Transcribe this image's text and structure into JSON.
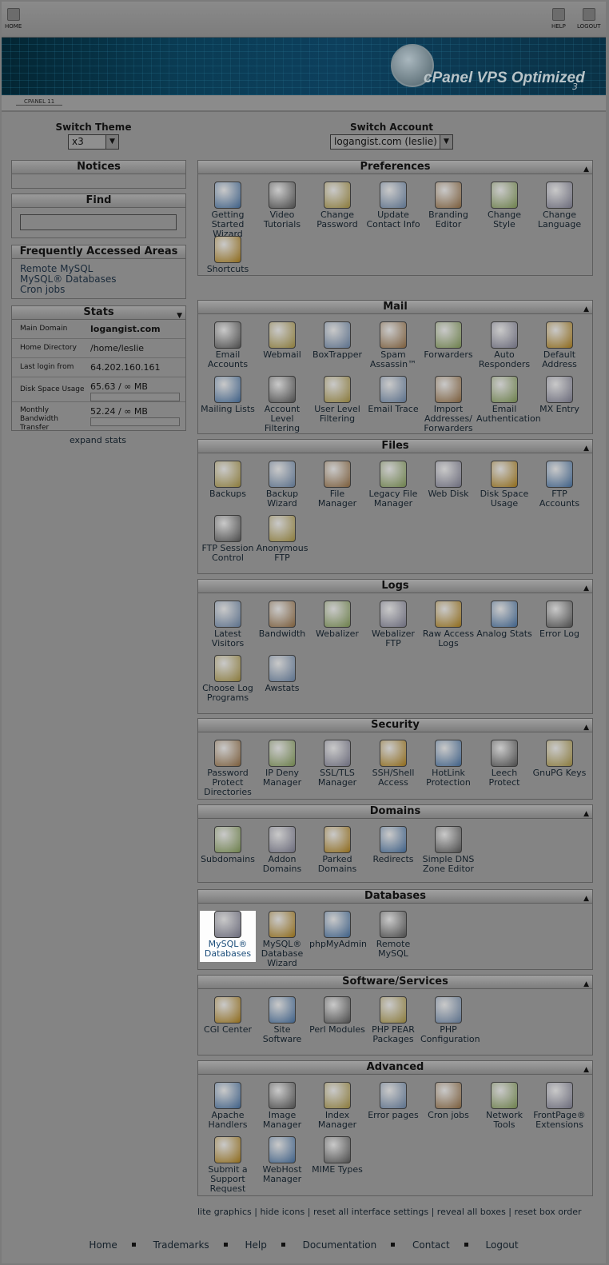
{
  "topbar": {
    "home_label": "HOME",
    "help_label": "HELP",
    "logout_label": "LOGOUT"
  },
  "banner": {
    "brand": "cPanel VPS Optimized",
    "brand_sub": "3"
  },
  "subbar": {
    "tab": "CPANEL 11"
  },
  "switch_theme": {
    "label": "Switch Theme",
    "value": "x3"
  },
  "switch_account": {
    "label": "Switch Account",
    "value": "logangist.com (leslie)"
  },
  "notices": {
    "title": "Notices"
  },
  "find": {
    "title": "Find"
  },
  "faa": {
    "title": "Frequently Accessed Areas",
    "links": [
      "Remote MySQL",
      "MySQL® Databases",
      "Cron jobs"
    ]
  },
  "stats": {
    "title": "Stats",
    "rows": [
      {
        "key": "Main Domain",
        "value": "logangist.com"
      },
      {
        "key": "Home Directory",
        "value": "/home/leslie"
      },
      {
        "key": "Last login from",
        "value": "64.202.160.161"
      },
      {
        "key": "Disk Space Usage",
        "value": "65.63 / ∞ MB"
      },
      {
        "key": "Monthly Bandwidth Transfer",
        "value": "52.24 / ∞ MB"
      }
    ],
    "expand": "expand stats"
  },
  "panels": [
    {
      "title": "Preferences",
      "items": [
        "Getting Started Wizard",
        "Video Tutorials",
        "Change Password",
        "Update Contact Info",
        "Branding Editor",
        "Change Style",
        "Change Language",
        "Shortcuts"
      ]
    },
    {
      "title": "Mail",
      "items": [
        "Email Accounts",
        "Webmail",
        "BoxTrapper",
        "Spam Assassin™",
        "Forwarders",
        "Auto Responders",
        "Default Address",
        "Mailing Lists",
        "Account Level Filtering",
        "User Level Filtering",
        "Email Trace",
        "Import Addresses/ Forwarders",
        "Email Authentication",
        "MX Entry"
      ]
    },
    {
      "title": "Files",
      "items": [
        "Backups",
        "Backup Wizard",
        "File Manager",
        "Legacy File Manager",
        "Web Disk",
        "Disk Space Usage",
        "FTP Accounts",
        "FTP Session Control",
        "Anonymous FTP"
      ]
    },
    {
      "title": "Logs",
      "items": [
        "Latest Visitors",
        "Bandwidth",
        "Webalizer",
        "Webalizer FTP",
        "Raw Access Logs",
        "Analog Stats",
        "Error Log",
        "Choose Log Programs",
        "Awstats"
      ]
    },
    {
      "title": "Security",
      "items": [
        "Password Protect Directories",
        "IP Deny Manager",
        "SSL/TLS Manager",
        "SSH/Shell Access",
        "HotLink Protection",
        "Leech Protect",
        "GnuPG Keys"
      ]
    },
    {
      "title": "Domains",
      "items": [
        "Subdomains",
        "Addon Domains",
        "Parked Domains",
        "Redirects",
        "Simple DNS Zone Editor"
      ]
    },
    {
      "title": "Databases",
      "items": [
        "MySQL® Databases",
        "MySQL® Database Wizard",
        "phpMyAdmin",
        "Remote MySQL"
      ]
    },
    {
      "title": "Software/Services",
      "items": [
        "CGI Center",
        "Site Software",
        "Perl Modules",
        "PHP PEAR Packages",
        "PHP Configuration"
      ]
    },
    {
      "title": "Advanced",
      "items": [
        "Apache Handlers",
        "Image Manager",
        "Index Manager",
        "Error pages",
        "Cron jobs",
        "Network Tools",
        "FrontPage® Extensions",
        "Submit a Support Request",
        "WebHost Manager",
        "MIME Types"
      ]
    }
  ],
  "footer_links": [
    "lite graphics",
    "hide icons",
    "reset all interface settings",
    "reveal all boxes",
    "reset box order"
  ],
  "bottom_nav": [
    "Home",
    "Trademarks",
    "Help",
    "Documentation",
    "Contact",
    "Logout"
  ],
  "icon_colors": [
    "#3d5f86",
    "#4a4a4a",
    "#8a7a3a",
    "#5a6f8a",
    "#7a5c3a",
    "#6c7f4a",
    "#6a6a7a",
    "#8e6a1a"
  ]
}
